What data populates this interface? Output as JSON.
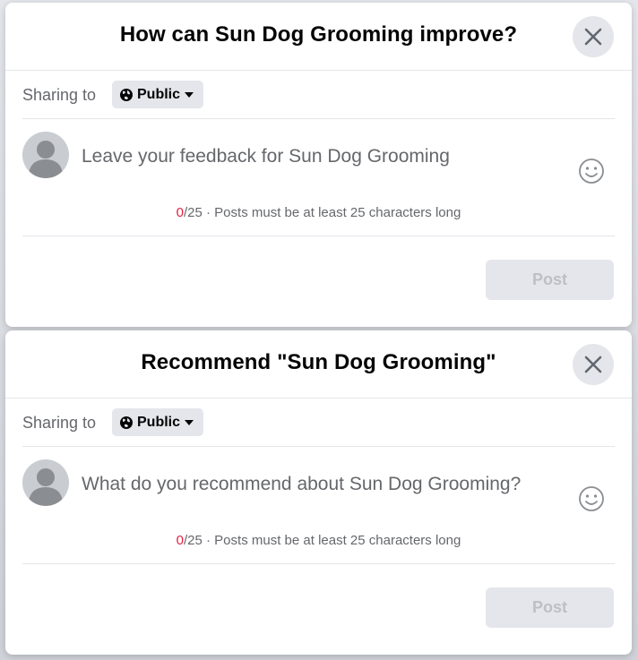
{
  "dialogs": [
    {
      "title": "How can Sun Dog Grooming improve?",
      "sharing_label": "Sharing to",
      "privacy": "Public",
      "placeholder": "Leave your feedback for Sun Dog Grooming",
      "count": "0",
      "count_rest": "/25 · Posts must be at least 25 characters long",
      "post_label": "Post"
    },
    {
      "title": "Recommend \"Sun Dog Grooming\"",
      "sharing_label": "Sharing to",
      "privacy": "Public",
      "placeholder": "What do you recommend about Sun Dog Grooming?",
      "count": "0",
      "count_rest": "/25 · Posts must be at least 25 characters long",
      "post_label": "Post"
    }
  ],
  "colors": {
    "counter_zero": "#e41e3f",
    "disabled_button_bg": "#e4e6eb",
    "disabled_button_text": "#bcc0c4",
    "secondary_text": "#65676b"
  },
  "icons": [
    "close-icon",
    "globe-icon",
    "caret-down-icon",
    "avatar-icon",
    "smiley-icon"
  ]
}
